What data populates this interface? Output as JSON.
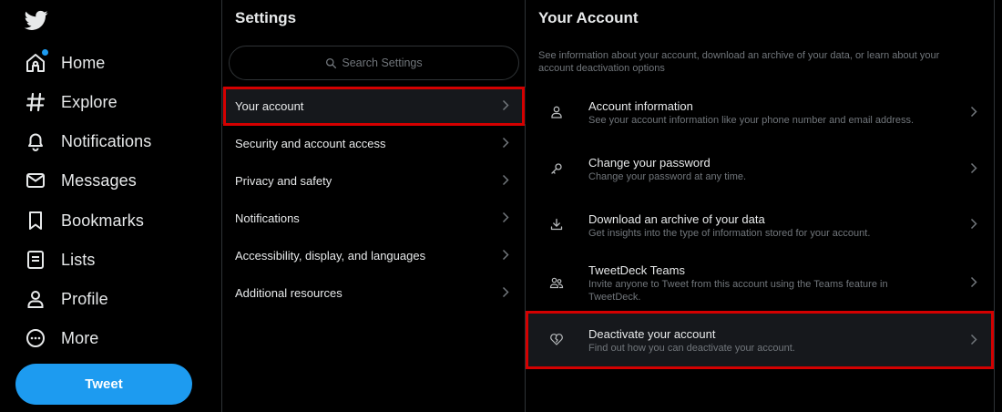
{
  "nav": {
    "logo": "twitter-bird-icon",
    "items": [
      {
        "label": "Home",
        "icon": "home-icon"
      },
      {
        "label": "Explore",
        "icon": "hashtag-icon"
      },
      {
        "label": "Notifications",
        "icon": "bell-icon"
      },
      {
        "label": "Messages",
        "icon": "envelope-icon"
      },
      {
        "label": "Bookmarks",
        "icon": "bookmark-icon"
      },
      {
        "label": "Lists",
        "icon": "list-icon"
      },
      {
        "label": "Profile",
        "icon": "person-icon"
      },
      {
        "label": "More",
        "icon": "more-circle-icon"
      }
    ],
    "tweet_label": "Tweet"
  },
  "settings": {
    "title": "Settings",
    "search_placeholder": "Search Settings",
    "items": [
      {
        "label": "Your account"
      },
      {
        "label": "Security and account access"
      },
      {
        "label": "Privacy and safety"
      },
      {
        "label": "Notifications"
      },
      {
        "label": "Accessibility, display, and languages"
      },
      {
        "label": "Additional resources"
      }
    ]
  },
  "account": {
    "title": "Your Account",
    "description": "See information about your account, download an archive of your data, or learn about your account deactivation options",
    "items": [
      {
        "title": "Account information",
        "desc": "See your account information like your phone number and email address.",
        "icon": "person-icon"
      },
      {
        "title": "Change your password",
        "desc": "Change your password at any time.",
        "icon": "key-icon"
      },
      {
        "title": "Download an archive of your data",
        "desc": "Get insights into the type of information stored for your account.",
        "icon": "download-icon"
      },
      {
        "title": "TweetDeck Teams",
        "desc": "Invite anyone to Tweet from this account using the Teams feature in TweetDeck.",
        "icon": "people-icon"
      },
      {
        "title": "Deactivate your account",
        "desc": "Find out how you can deactivate your account.",
        "icon": "broken-heart-icon"
      }
    ]
  },
  "colors": {
    "accent": "#1d9bf0",
    "highlight": "#d40000",
    "background": "#000000",
    "text": "#e7e9ea",
    "secondary_text": "#71767b"
  }
}
